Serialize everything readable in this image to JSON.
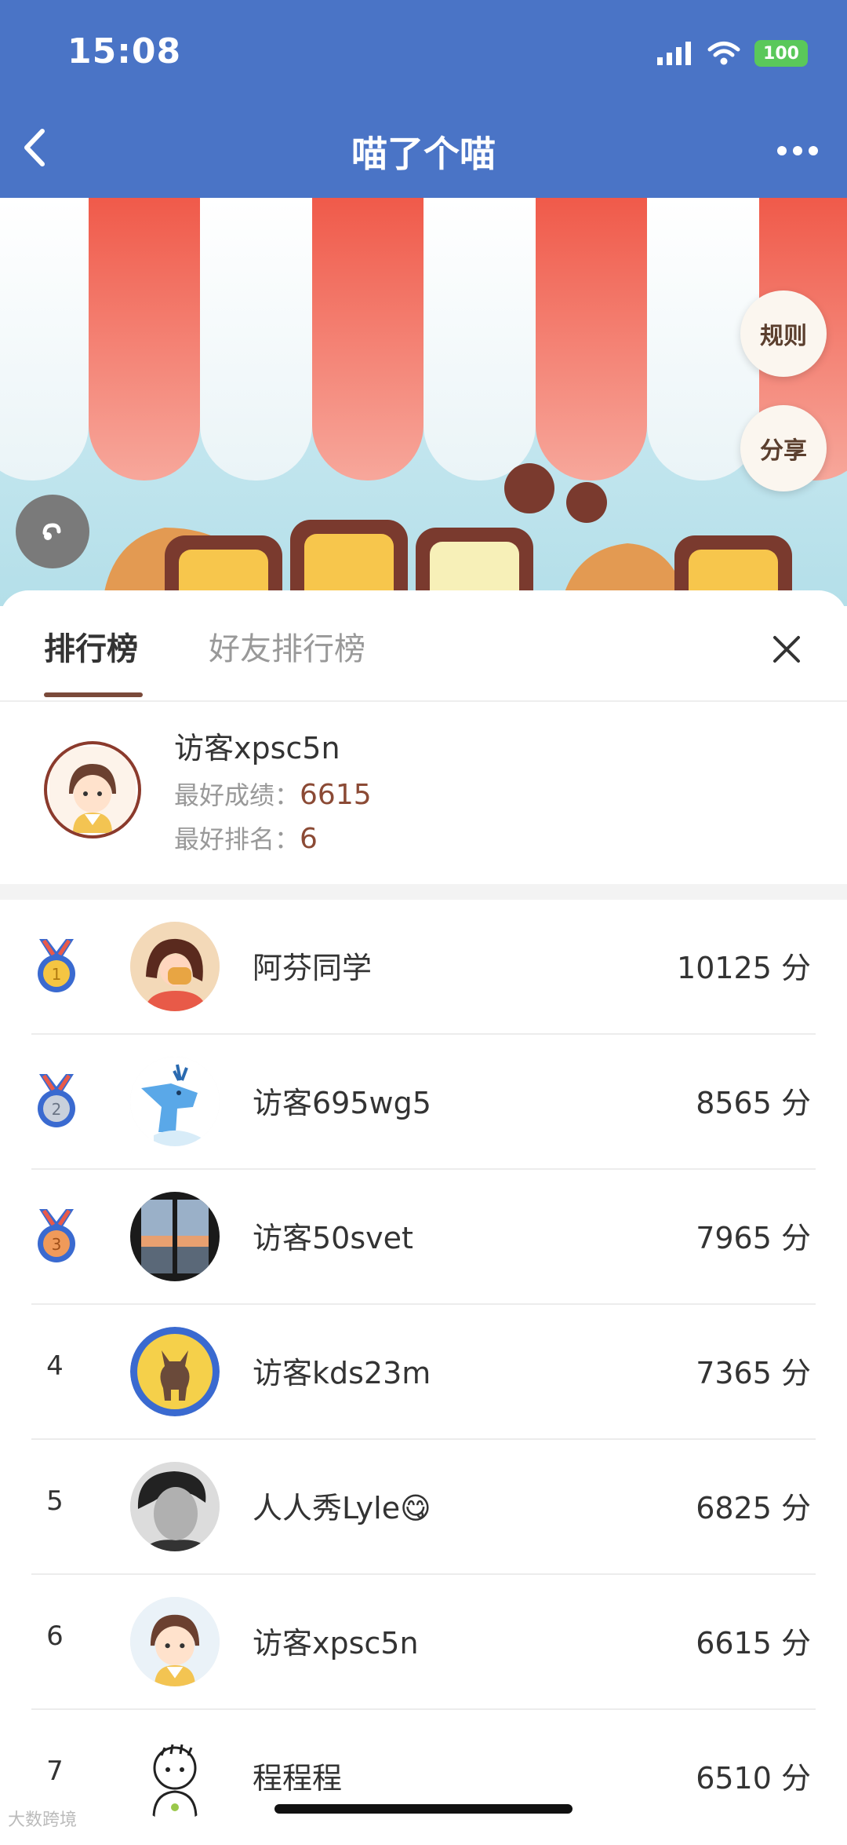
{
  "status_bar": {
    "time": "15:08",
    "battery": "100"
  },
  "header": {
    "title": "喵了个喵"
  },
  "banner": {
    "rules_label": "规则",
    "share_label": "分享"
  },
  "tabs": [
    {
      "label": "排行榜",
      "active": true
    },
    {
      "label": "好友排行榜",
      "active": false
    }
  ],
  "my_record": {
    "name": "访客xpsc5n",
    "best_score_label": "最好成绩：",
    "best_score": "6615",
    "best_rank_label": "最好排名：",
    "best_rank": "6"
  },
  "ranking": [
    {
      "rank": "1",
      "medal": "gold",
      "name": "阿芬同学",
      "score": "10125 分",
      "avatar": "girl-cartoon-avatar"
    },
    {
      "rank": "2",
      "medal": "silver",
      "name": "访客695wg5",
      "score": "8565 分",
      "avatar": "deer-avatar"
    },
    {
      "rank": "3",
      "medal": "bronze",
      "name": "访客50svet",
      "score": "7965 分",
      "avatar": "sunset-window-avatar"
    },
    {
      "rank": "4",
      "medal": "",
      "name": "访客kds23m",
      "score": "7365 分",
      "avatar": "dog-yellow-avatar"
    },
    {
      "rank": "5",
      "medal": "",
      "name": "人人秀Lyle😋",
      "score": "6825 分",
      "avatar": "portrait-avatar"
    },
    {
      "rank": "6",
      "medal": "",
      "name": "访客xpsc5n",
      "score": "6615 分",
      "avatar": "girl-default-avatar"
    },
    {
      "rank": "7",
      "medal": "",
      "name": "程程程",
      "score": "6510 分",
      "avatar": "line-drawing-avatar"
    }
  ],
  "watermark": "大数跨境",
  "colors": {
    "header_bg": "#4a74c6",
    "accent_brown": "#7a4a3a",
    "score_brown": "#8b4a35"
  }
}
